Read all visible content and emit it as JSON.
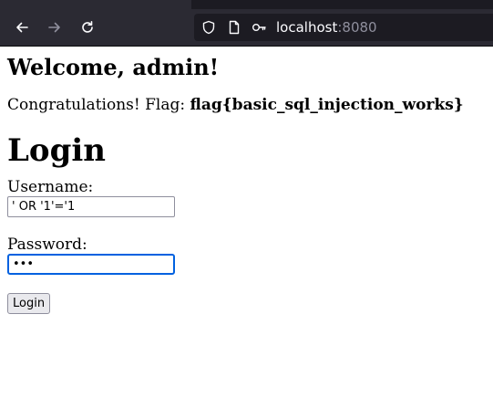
{
  "browser": {
    "url_host": "localhost",
    "url_port": ":8080",
    "icons": {
      "back": "back-arrow-icon",
      "forward": "forward-arrow-icon",
      "reload": "reload-icon",
      "shield": "tracking-shield-icon",
      "page": "page-icon",
      "key": "key-icon"
    },
    "colors": {
      "toolbar": "#2b2a33",
      "urlbar": "#1c1b22",
      "focus_ring": "#0061e0"
    }
  },
  "page": {
    "welcome": "Welcome, admin!",
    "flag_prefix": "Congratulations! Flag: ",
    "flag_value": "flag{basic_sql_injection_works}",
    "login_title": "Login",
    "form": {
      "username_label": "Username:",
      "username_value": "' OR '1'='1",
      "password_label": "Password:",
      "password_value": "abc",
      "submit_label": "Login"
    }
  }
}
